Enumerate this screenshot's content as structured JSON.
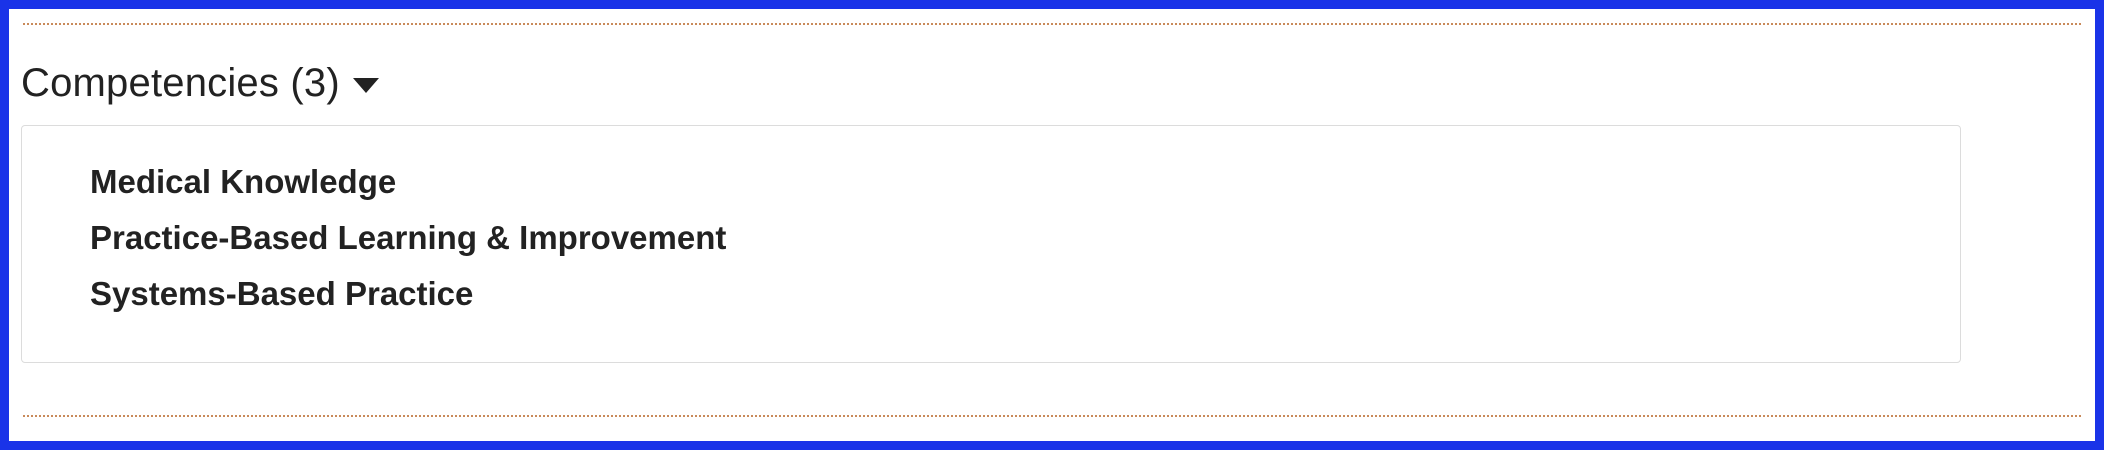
{
  "section": {
    "title": "Competencies (3)",
    "toggle_icon": "caret-down-icon",
    "expanded": true
  },
  "competencies": [
    {
      "label": "Medical Knowledge"
    },
    {
      "label": "Practice-Based Learning & Improvement"
    },
    {
      "label": "Systems-Based Practice"
    }
  ],
  "colors": {
    "frame_border": "#1a33e8",
    "divider": "#c98a5a",
    "panel_border": "#dcdcdc",
    "text": "#222222"
  }
}
